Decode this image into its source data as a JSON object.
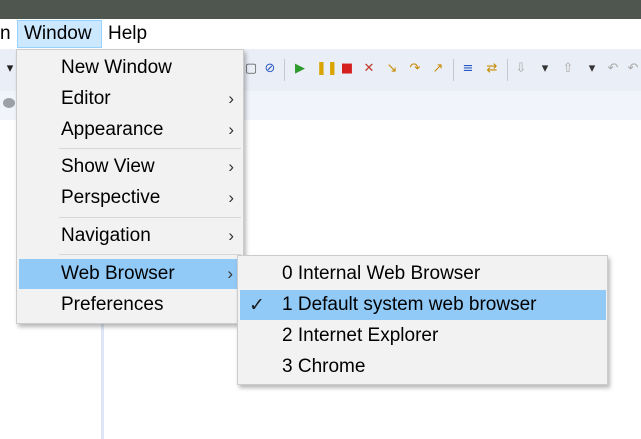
{
  "menubar": {
    "items": [
      {
        "label": "n"
      },
      {
        "label": "Window",
        "active": true
      },
      {
        "label": "Help"
      }
    ]
  },
  "toolbar_icons": [
    "dropdown-arrow-icon",
    "toolbar-icon",
    "breakpoint-skip-icon",
    "resume-icon",
    "suspend-icon",
    "terminate-icon",
    "disconnect-icon",
    "step-into-icon",
    "step-over-icon",
    "step-return-icon",
    "drop-to-frame-icon",
    "use-step-filters-icon",
    "next-annotation-icon",
    "dropdown-arrow-icon",
    "previous-annotation-icon",
    "dropdown-arrow-icon",
    "back-icon",
    "forward-icon"
  ],
  "window_menu": {
    "items": [
      {
        "label": "New Window",
        "submenu": false
      },
      {
        "label": "Editor",
        "submenu": true
      },
      {
        "label": "Appearance",
        "submenu": true
      },
      {
        "label": "Show View",
        "submenu": true
      },
      {
        "label": "Perspective",
        "submenu": true
      },
      {
        "label": "Navigation",
        "submenu": true
      },
      {
        "label": "Web Browser",
        "submenu": true,
        "highlighted": true
      },
      {
        "label": "Preferences",
        "submenu": false
      }
    ]
  },
  "web_browser_submenu": {
    "items": [
      {
        "label": "0 Internal Web Browser",
        "checked": false
      },
      {
        "label": "1 Default system web browser",
        "checked": true
      },
      {
        "label": "2 Internet Explorer",
        "checked": false
      },
      {
        "label": "3 Chrome",
        "checked": false
      }
    ]
  },
  "colors": {
    "highlight": "#91c9f7",
    "menu_bg": "#f2f2f2",
    "toolbar_bg": "#eaeef7",
    "titlebar": "#4f5650"
  },
  "glyphs": {
    "chevron": "›",
    "check": "✓"
  }
}
